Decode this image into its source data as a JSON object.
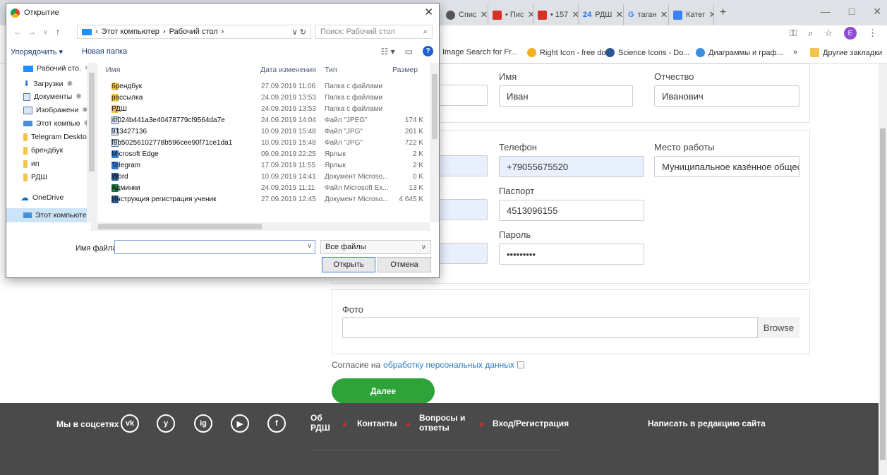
{
  "browser": {
    "tabs": [
      {
        "label": "Спис",
        "favicon_color": "#555555"
      },
      {
        "label": "• Пис",
        "favicon_color": "#d93025"
      },
      {
        "label": "• 157",
        "favicon_color": "#d93025"
      },
      {
        "label": "РДШ",
        "badge": "24",
        "favicon_color": "#1a73e8"
      },
      {
        "label": "таган",
        "favicon_color": "#4285f4"
      },
      {
        "label": "Катег",
        "favicon_color": "#3b82f6"
      }
    ],
    "new_tab": "+",
    "window_controls": [
      "—",
      "□",
      "✕"
    ],
    "profile_initial": "E",
    "bookmarks": [
      {
        "label": "Image Search for Fr...",
        "color": "#888888"
      },
      {
        "label": "Right Icon - free do...",
        "color": "#f2b01e"
      },
      {
        "label": "Science Icons - Do...",
        "color": "#2b5797"
      },
      {
        "label": "Диаграммы и граф...",
        "color": "#3c8dde"
      },
      {
        "label": "Другие закладки",
        "color": "#f2c54a"
      }
    ],
    "bookmarks_more": "»"
  },
  "form": {
    "name_label": "Имя",
    "name_value": "Иван",
    "patronymic_label": "Отчество",
    "patronymic_value": "Иванович",
    "phone_label": "Телефон",
    "phone_value": "+79055675520",
    "work_label": "Место работы",
    "work_value": "Муниципальное казённое общеоб",
    "passport_label": "Паспорт",
    "passport_value": "4513096155",
    "password_label": "Пароль",
    "password_value": "•••••••••",
    "photo_label": "Фото",
    "browse_label": "Browse",
    "consent_prefix": "Согласие на",
    "consent_link": "обработку персональных данных",
    "next_label": "Далее"
  },
  "footer": {
    "social_label": "Мы в соцсетях",
    "social_icons": [
      "vk",
      "y",
      "ig",
      "▶",
      "f"
    ],
    "links": [
      "Об РДШ",
      "Контакты",
      "Вопросы и ответы",
      "Вход/Регистрация"
    ],
    "write_label": "Написать в редакцию сайта"
  },
  "dialog": {
    "title": "Открытие",
    "path": [
      "Этот компьютер",
      "Рабочий стол"
    ],
    "search_placeholder": "Поиск: Рабочий стол",
    "organize": "Упорядочить ▾",
    "new_folder": "Новая папка",
    "nav_items": [
      {
        "label": "Рабочий сто.",
        "icon": "desktop"
      },
      {
        "label": "Загрузки",
        "icon": "downloads"
      },
      {
        "label": "Документы",
        "icon": "documents"
      },
      {
        "label": "Изображени",
        "icon": "pictures"
      },
      {
        "label": "Этот компью",
        "icon": "computer"
      },
      {
        "label": "Telegram Deskto",
        "icon": "folder"
      },
      {
        "label": "брендбук",
        "icon": "folder"
      },
      {
        "label": "ип",
        "icon": "folder"
      },
      {
        "label": "РДШ",
        "icon": "folder"
      },
      {
        "label": "OneDrive",
        "icon": "cloud"
      },
      {
        "label": "Этот компьютер",
        "icon": "computer"
      }
    ],
    "columns": [
      "Имя",
      "Дата изменения",
      "Тип",
      "Размер"
    ],
    "files": [
      {
        "name": "брендбук",
        "date": "27.09.2019 11:06",
        "type": "Папка с файлами",
        "size": "",
        "icon": "folder"
      },
      {
        "name": "рассылка",
        "date": "24.09.2019 13:53",
        "type": "Папка с файлами",
        "size": "",
        "icon": "folder"
      },
      {
        "name": "РДШ",
        "date": "24.09.2019 13:53",
        "type": "Папка с файлами",
        "size": "",
        "icon": "folder"
      },
      {
        "name": "4f024b441a3e40478779cf9564da7e",
        "date": "24.09.2019 14:04",
        "type": "Файл \"JPEG\"",
        "size": "174 K",
        "icon": "img"
      },
      {
        "name": "913427136",
        "date": "10.09.2019 15:48",
        "type": "Файл \"JPG\"",
        "size": "261 K",
        "icon": "img"
      },
      {
        "name": "f8b50256102778b596cee90f71ce1da1",
        "date": "10.09.2019 15:48",
        "type": "Файл \"JPG\"",
        "size": "722 K",
        "icon": "img"
      },
      {
        "name": "Microsoft Edge",
        "date": "09.09.2019 22:25",
        "type": "Ярлык",
        "size": "2 K",
        "icon": "lnk"
      },
      {
        "name": "Telegram",
        "date": "17.09.2019 11:55",
        "type": "Ярлык",
        "size": "2 K",
        "icon": "lnk"
      },
      {
        "name": "Word",
        "date": "10.09.2019 14:41",
        "type": "Документ Microso...",
        "size": "0 K",
        "icon": "doc"
      },
      {
        "name": "Админки",
        "date": "24.09.2019 11:11",
        "type": "Файл Microsoft Ex...",
        "size": "13 K",
        "icon": "xls"
      },
      {
        "name": "Инструкция регистрация ученик",
        "date": "27.09.2019 12:45",
        "type": "Документ Microso...",
        "size": "4 645 K",
        "icon": "doc"
      }
    ],
    "filename_label": "Имя файла:",
    "filename_value": "",
    "filter": "Все файлы",
    "open_label": "Открыть",
    "cancel_label": "Отмена"
  }
}
